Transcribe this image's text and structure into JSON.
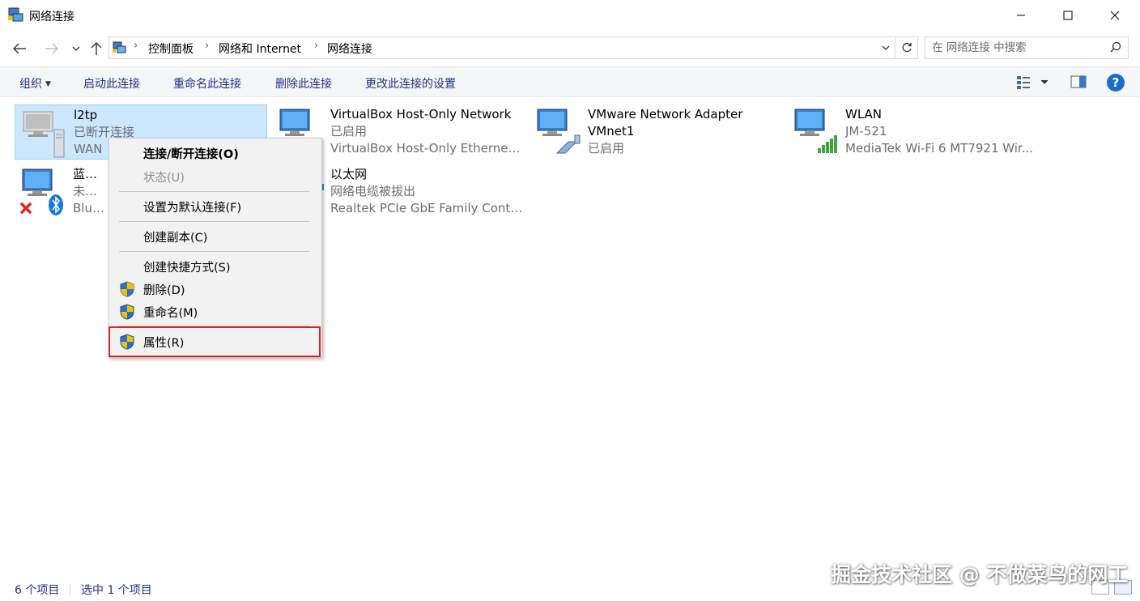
{
  "window": {
    "title": "网络连接",
    "minimize_icon": "minimize-icon",
    "maximize_icon": "maximize-icon",
    "close_icon": "close-icon"
  },
  "nav": {
    "back_icon": "arrow-left-icon",
    "forward_icon": "arrow-right-icon",
    "recent_icon": "chevron-down-icon",
    "up_icon": "arrow-up-icon",
    "breadcrumbs": [
      "控制面板",
      "网络和 Internet",
      "网络连接"
    ],
    "refresh_icon": "refresh-icon",
    "search_placeholder": "在 网络连接 中搜索"
  },
  "commands": {
    "organize": "组织",
    "start": "启动此连接",
    "rename": "重命名此连接",
    "delete": "删除此连接",
    "change_settings": "更改此连接的设置"
  },
  "connections": [
    {
      "name": "l2tp",
      "status": "已断开连接",
      "device": "WAN",
      "selected": true,
      "icon": "vpn-connection-icon"
    },
    {
      "name": "VirtualBox Host-Only Network",
      "status": "已启用",
      "device": "VirtualBox Host-Only Ethernet ...",
      "icon": "network-adapter-icon"
    },
    {
      "name": "VMware Network Adapter VMnet1",
      "status": "已启用",
      "device": "",
      "icon": "network-adapter-icon"
    },
    {
      "name": "WLAN",
      "status": "JM-521",
      "device": "MediaTek Wi-Fi 6 MT7921 Wir...",
      "icon": "wifi-adapter-icon"
    },
    {
      "name": "蓝牙网",
      "status": "未连接",
      "device": "Blueto",
      "icon": "bluetooth-adapter-icon"
    },
    {
      "name": "以太网",
      "status": "网络电缆被拔出",
      "device": "Realtek PCIe GbE Family Contr...",
      "icon": "ethernet-adapter-icon"
    }
  ],
  "context_menu": {
    "connect": "连接/断开连接(O)",
    "status": "状态(U)",
    "set_default": "设置为默认连接(F)",
    "copy": "创建副本(C)",
    "shortcut": "创建快捷方式(S)",
    "delete": "删除(D)",
    "rename": "重命名(M)",
    "properties": "属性(R)"
  },
  "status_bar": {
    "count": "6 个项目",
    "selected": "选中 1 个项目"
  },
  "watermark": "掘金技术社区 @ 不做菜鸟的网工",
  "colors": {
    "accent": "#1e3287",
    "selection_bg": "#cce8ff",
    "highlight_border": "#e02020",
    "help_blue": "#1d6cc8"
  }
}
